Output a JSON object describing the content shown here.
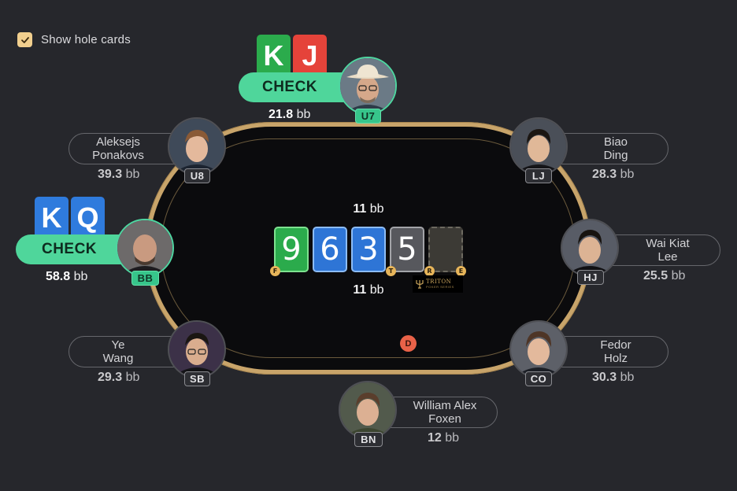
{
  "toggle": {
    "label": "Show hole cards",
    "checked": true
  },
  "pot": {
    "top_value": "11",
    "bottom_value": "11",
    "unit": "bb"
  },
  "board": [
    {
      "rank": "9",
      "color": "green"
    },
    {
      "rank": "6",
      "color": "blue"
    },
    {
      "rank": "3",
      "color": "blue"
    },
    {
      "rank": "5",
      "color": "gray"
    },
    {
      "rank": "",
      "color": "empty"
    }
  ],
  "street_markers": {
    "flop": "F",
    "turn": "T",
    "river": "R",
    "end": "E"
  },
  "dealer_button": "D",
  "logo": {
    "text": "TRITON",
    "sub": "POKER SERIES"
  },
  "colors": {
    "accent": "#4fd69b",
    "rail": "#c8a46a",
    "felt": "#0b0b0d",
    "background": "#26272c",
    "dealer": "#e96248"
  },
  "players": {
    "u7": {
      "position": "U7",
      "stack": "21.8",
      "unit": "bb",
      "action": "CHECK",
      "cards": [
        "K",
        "J"
      ],
      "card_colors": [
        "green",
        "red"
      ]
    },
    "u8": {
      "name1": "Aleksejs",
      "name2": "Ponakovs",
      "position": "U8",
      "stack": "39.3",
      "unit": "bb"
    },
    "lj": {
      "name1": "Biao",
      "name2": "Ding",
      "position": "LJ",
      "stack": "28.3",
      "unit": "bb"
    },
    "hj": {
      "name1": "Wai Kiat",
      "name2": "Lee",
      "position": "HJ",
      "stack": "25.5",
      "unit": "bb"
    },
    "bb": {
      "position": "BB",
      "stack": "58.8",
      "unit": "bb",
      "action": "CHECK",
      "cards": [
        "K",
        "Q"
      ],
      "card_colors": [
        "blue",
        "blue"
      ]
    },
    "sb": {
      "name1": "Ye",
      "name2": "Wang",
      "position": "SB",
      "stack": "29.3",
      "unit": "bb"
    },
    "co": {
      "name1": "Fedor",
      "name2": "Holz",
      "position": "CO",
      "stack": "30.3",
      "unit": "bb"
    },
    "bn": {
      "name1": "William Alex",
      "name2": "Foxen",
      "position": "BN",
      "stack": "12",
      "unit": "bb"
    }
  }
}
